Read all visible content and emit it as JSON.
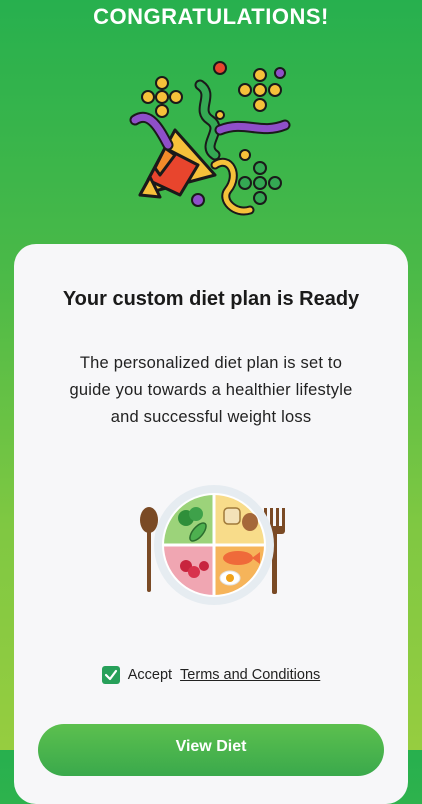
{
  "header": {
    "title": "CONGRATULATIONS!"
  },
  "card": {
    "title": "Your custom diet plan is Ready",
    "body_lines": [
      "The personalized diet plan is set to",
      "guide you towards a healthier lifestyle",
      "and successful weight loss"
    ],
    "accept_prefix": "Accept",
    "terms_link": "Terms and Conditions",
    "checkbox_checked": true,
    "button_label": "View Diet"
  },
  "colors": {
    "accent_green": "#27a05a",
    "header_green": "#27b04e",
    "lime_green": "#96cd40"
  },
  "icons": [
    "party-popper-icon",
    "diet-plate-icon",
    "spoon-icon",
    "fork-icon",
    "checkmark-icon"
  ]
}
